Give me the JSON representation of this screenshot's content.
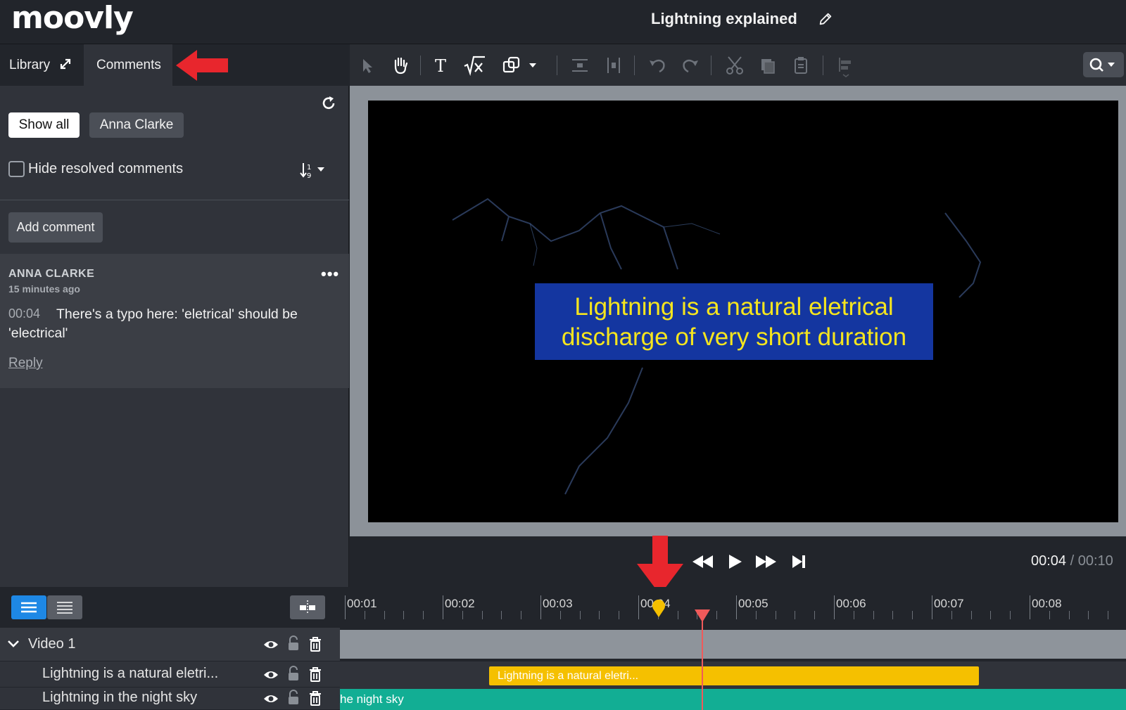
{
  "app": {
    "logo": "moovly",
    "title": "Lightning explained"
  },
  "left_panel": {
    "tabs": [
      {
        "label": "Library"
      },
      {
        "label": "Comments"
      }
    ],
    "filters": {
      "show_all": "Show all",
      "user": "Anna Clarke"
    },
    "hide_resolved_label": "Hide resolved comments",
    "hide_resolved_checked": false,
    "add_comment_label": "Add comment",
    "comment": {
      "author": "ANNA CLARKE",
      "time_ago": "15 minutes ago",
      "timestamp": "00:04",
      "text": "There's a typo here: 'eletrical' should be 'electrical'",
      "reply_label": "Reply",
      "more_label": "•••"
    }
  },
  "toolbar": {
    "icons": [
      "select-arrow-icon",
      "hand-icon",
      "text-icon",
      "formula-icon",
      "shapes-icon",
      "distribute-vertical-icon",
      "distribute-horizontal-icon",
      "undo-icon",
      "redo-icon",
      "cut-icon",
      "copy-icon",
      "paste-icon",
      "align-icon",
      "search-icon"
    ]
  },
  "stage": {
    "caption_line1": "Lightning is a natural eletrical",
    "caption_line2": "discharge of very short duration",
    "caption_bg": "#1436a0",
    "caption_color": "#f5e51e"
  },
  "player": {
    "current": "00:04",
    "separator": "/",
    "total": "00:10"
  },
  "timeline": {
    "ruler": [
      "00:01",
      "00:02",
      "00:03",
      "00:04",
      "00:05",
      "00:06",
      "00:07",
      "00:08"
    ],
    "tracks": [
      {
        "name": "Video 1"
      },
      {
        "name": "Lightning is a natural eletri...",
        "clip_label": "Lightning is a natural eletri...",
        "color": "#f5c000"
      },
      {
        "name": "Lightning in the night sky",
        "clip_label": "he night sky",
        "color": "#12ae94"
      }
    ]
  },
  "colors": {
    "accent_blue": "#1e88e5",
    "annotation_red": "#e8262d",
    "playhead": "#f05a5a",
    "marker": "#f5c000"
  }
}
